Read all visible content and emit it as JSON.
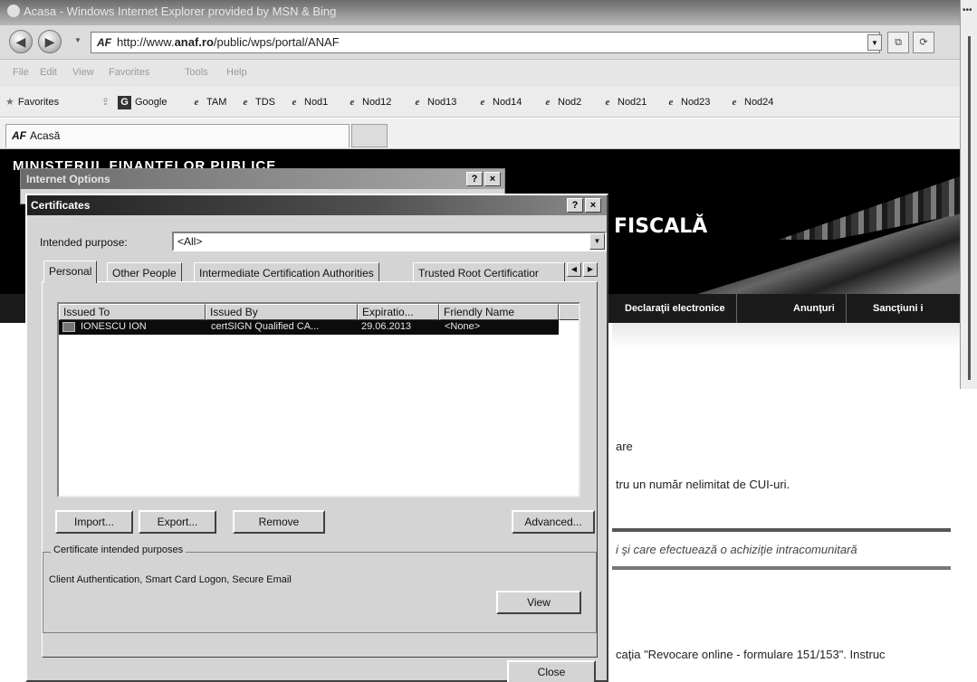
{
  "browser": {
    "title": "Acasa - Windows Internet Explorer provided by MSN & Bing",
    "address_prefix": "http://www.",
    "address_domain": "anaf.ro",
    "address_suffix": "/public/wps/portal/ANAF",
    "favicon_text": "AF",
    "menu": [
      "File",
      "Edit",
      "View",
      "Favorites",
      "Tools",
      "Help"
    ],
    "favorites_label": "Favorites",
    "favorites": [
      "Google",
      "TAM",
      "TDS",
      "Nod1",
      "Nod12",
      "Nod13",
      "Nod14",
      "Nod2",
      "Nod21",
      "Nod23",
      "Nod24"
    ],
    "tab_title": "Acasă"
  },
  "site": {
    "ministry": "MINISTERUL FINANTELOR PUBLICE",
    "agency": "FISCALĂ",
    "nav": [
      "Declaraţii electronice",
      "Anunţuri",
      "Sancţiuni i"
    ],
    "text_lines": [
      "are",
      "tru un număr nelimitat de CUI-uri.",
      "i şi care efectuează o achiziţie intracomunitară",
      "caţia \"Revocare online - formulare 151/153\". Instruc"
    ]
  },
  "internet_options": {
    "title": "Internet Options",
    "help": "?",
    "close": "×"
  },
  "certificates": {
    "title": "Certificates",
    "help": "?",
    "close": "×",
    "purpose_label": "Intended purpose:",
    "purpose_value": "<All>",
    "tabs": [
      "Personal",
      "Other People",
      "Intermediate Certification Authorities",
      "Trusted Root Certificatior"
    ],
    "columns": [
      "Issued To",
      "Issued By",
      "Expiratio...",
      "Friendly Name"
    ],
    "rows": [
      {
        "issued_to": "IONESCU ION",
        "issued_by": "certSIGN Qualified CA...",
        "expiration": "29.06.2013",
        "friendly_name": "<None>"
      }
    ],
    "buttons": {
      "import": "Import...",
      "export": "Export...",
      "remove": "Remove",
      "advanced": "Advanced...",
      "view": "View",
      "close": "Close"
    },
    "purposes_group_label": "Certificate intended purposes",
    "purposes_text": "Client Authentication, Smart Card Logon, Secure Email"
  }
}
